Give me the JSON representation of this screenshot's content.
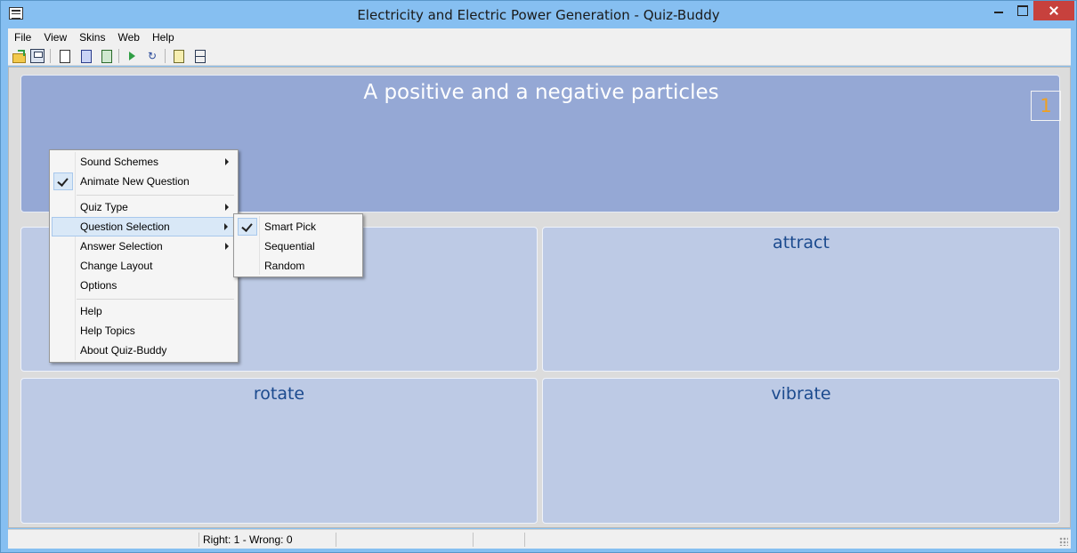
{
  "window": {
    "title": "Electricity and Electric Power Generation - Quiz-Buddy"
  },
  "menubar": {
    "items": [
      "File",
      "View",
      "Skins",
      "Web",
      "Help"
    ]
  },
  "toolbar": {
    "icons": [
      "open-folder-icon",
      "save-icon",
      "new-document-icon",
      "document-icon",
      "document-green-icon",
      "play-icon",
      "refresh-icon",
      "note-icon",
      "layout-icon"
    ]
  },
  "quiz": {
    "question": "A positive and a negative particles",
    "number": "1",
    "answers": [
      "",
      "attract",
      "rotate",
      "vibrate"
    ]
  },
  "context_menu": {
    "items": [
      {
        "label": "Sound Schemes",
        "submenu": true
      },
      {
        "label": "Animate New Question",
        "checked": true
      },
      {
        "label": "Quiz Type",
        "submenu": true
      },
      {
        "label": "Question Selection",
        "submenu": true,
        "highlighted": true
      },
      {
        "label": "Answer Selection",
        "submenu": true
      },
      {
        "label": "Change Layout"
      },
      {
        "label": "Options"
      },
      {
        "label": "Help"
      },
      {
        "label": "Help Topics"
      },
      {
        "label": "About Quiz-Buddy"
      }
    ]
  },
  "submenu": {
    "items": [
      {
        "label": "Smart Pick",
        "checked": true
      },
      {
        "label": "Sequential"
      },
      {
        "label": "Random"
      }
    ]
  },
  "statusbar": {
    "score": "Right: 1 - Wrong: 0"
  },
  "colors": {
    "question_bg": "#95a8d5",
    "answer_bg": "#bdcae5",
    "answer_text": "#1b4a8e",
    "number_color": "#f0a020",
    "titlebar": "#86bff1"
  }
}
